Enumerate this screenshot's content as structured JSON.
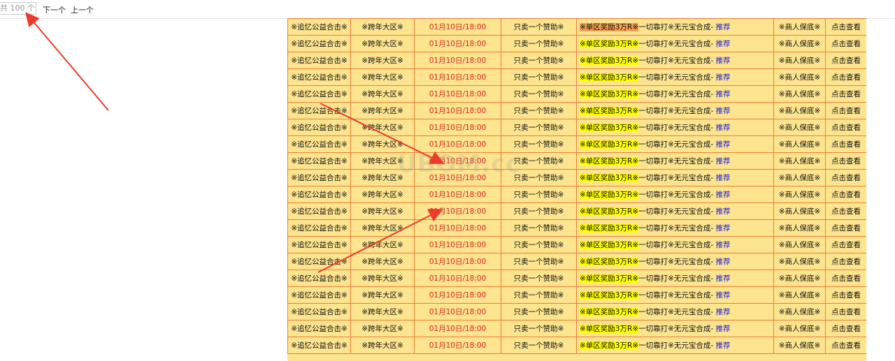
{
  "find_bar": {
    "count_text": "共 100 个",
    "next_label": "下一个",
    "prev_label": "上一个"
  },
  "watermark": "UBOM.cc",
  "colors": {
    "table_bg": "#fde48f",
    "border": "#f07d35",
    "date_text": "#dd2222",
    "highlight": "#ffff00",
    "highlight_current": "#f5a050",
    "link": "#2020d8",
    "arrow": "#ee3a2a"
  },
  "rows": [
    {
      "name": "※追忆公益合击※",
      "zone": "※跨年大区※",
      "date": "01月10日/18:00",
      "slogan": "只卖一个赞助※",
      "desc_hl": "※单区奖励3万R※",
      "desc_rest": "一切靠打※无元宝合成-",
      "rec": "推荐",
      "guarantee": "※商人保底※",
      "view": "点击查看"
    },
    {
      "name": "※追忆公益合击※",
      "zone": "※跨年大区※",
      "date": "01月10日/18:00",
      "slogan": "只卖一个赞助※",
      "desc_hl": "※单区奖励3万R※",
      "desc_rest": "一切靠打※无元宝合成-",
      "rec": "推荐",
      "guarantee": "※商人保底※",
      "view": "点击查看"
    },
    {
      "name": "※追忆公益合击※",
      "zone": "※跨年大区※",
      "date": "01月10日/18:00",
      "slogan": "只卖一个赞助※",
      "desc_hl": "※单区奖励3万R※",
      "desc_rest": "一切靠打※无元宝合成-",
      "rec": "推荐",
      "guarantee": "※商人保底※",
      "view": "点击查看"
    },
    {
      "name": "※追忆公益合击※",
      "zone": "※跨年大区※",
      "date": "01月10日/18:00",
      "slogan": "只卖一个赞助※",
      "desc_hl": "※单区奖励3万R※",
      "desc_rest": "一切靠打※无元宝合成-",
      "rec": "推荐",
      "guarantee": "※商人保底※",
      "view": "点击查看"
    },
    {
      "name": "※追忆公益合击※",
      "zone": "※跨年大区※",
      "date": "01月10日/18:00",
      "slogan": "只卖一个赞助※",
      "desc_hl": "※单区奖励3万R※",
      "desc_rest": "一切靠打※无元宝合成-",
      "rec": "推荐",
      "guarantee": "※商人保底※",
      "view": "点击查看"
    },
    {
      "name": "※追忆公益合击※",
      "zone": "※跨年大区※",
      "date": "01月10日/18:00",
      "slogan": "只卖一个赞助※",
      "desc_hl": "※单区奖励3万R※",
      "desc_rest": "一切靠打※无元宝合成-",
      "rec": "推荐",
      "guarantee": "※商人保底※",
      "view": "点击查看"
    },
    {
      "name": "※追忆公益合击※",
      "zone": "※跨年大区※",
      "date": "01月10日/18:00",
      "slogan": "只卖一个赞助※",
      "desc_hl": "※单区奖励3万R※",
      "desc_rest": "一切靠打※无元宝合成-",
      "rec": "推荐",
      "guarantee": "※商人保底※",
      "view": "点击查看"
    },
    {
      "name": "※追忆公益合击※",
      "zone": "※跨年大区※",
      "date": "01月10日/18:00",
      "slogan": "只卖一个赞助※",
      "desc_hl": "※单区奖励3万R※",
      "desc_rest": "一切靠打※无元宝合成-",
      "rec": "推荐",
      "guarantee": "※商人保底※",
      "view": "点击查看"
    },
    {
      "name": "※追忆公益合击※",
      "zone": "※跨年大区※",
      "date": "01月10日/18:00",
      "slogan": "只卖一个赞助※",
      "desc_hl": "※单区奖励3万R※",
      "desc_rest": "一切靠打※无元宝合成-",
      "rec": "推荐",
      "guarantee": "※商人保底※",
      "view": "点击查看"
    },
    {
      "name": "※追忆公益合击※",
      "zone": "※跨年大区※",
      "date": "01月10日/18:00",
      "slogan": "只卖一个赞助※",
      "desc_hl": "※单区奖励3万R※",
      "desc_rest": "一切靠打※无元宝合成-",
      "rec": "推荐",
      "guarantee": "※商人保底※",
      "view": "点击查看"
    },
    {
      "name": "※追忆公益合击※",
      "zone": "※跨年大区※",
      "date": "01月10日/18:00",
      "slogan": "只卖一个赞助※",
      "desc_hl": "※单区奖励3万R※",
      "desc_rest": "一切靠打※无元宝合成-",
      "rec": "推荐",
      "guarantee": "※商人保底※",
      "view": "点击查看"
    },
    {
      "name": "※追忆公益合击※",
      "zone": "※跨年大区※",
      "date": "01月10日/18:00",
      "slogan": "只卖一个赞助※",
      "desc_hl": "※单区奖励3万R※",
      "desc_rest": "一切靠打※无元宝合成-",
      "rec": "推荐",
      "guarantee": "※商人保底※",
      "view": "点击查看"
    },
    {
      "name": "※追忆公益合击※",
      "zone": "※跨年大区※",
      "date": "01月10日/18:00",
      "slogan": "只卖一个赞助※",
      "desc_hl": "※单区奖励3万R※",
      "desc_rest": "一切靠打※无元宝合成-",
      "rec": "推荐",
      "guarantee": "※商人保底※",
      "view": "点击查看"
    },
    {
      "name": "※追忆公益合击※",
      "zone": "※跨年大区※",
      "date": "01月10日/18:00",
      "slogan": "只卖一个赞助※",
      "desc_hl": "※单区奖励3万R※",
      "desc_rest": "一切靠打※无元宝合成-",
      "rec": "推荐",
      "guarantee": "※商人保底※",
      "view": "点击查看"
    },
    {
      "name": "※追忆公益合击※",
      "zone": "※跨年大区※",
      "date": "01月10日/18:00",
      "slogan": "只卖一个赞助※",
      "desc_hl": "※单区奖励3万R※",
      "desc_rest": "一切靠打※无元宝合成-",
      "rec": "推荐",
      "guarantee": "※商人保底※",
      "view": "点击查看"
    },
    {
      "name": "※追忆公益合击※",
      "zone": "※跨年大区※",
      "date": "01月10日/18:00",
      "slogan": "只卖一个赞助※",
      "desc_hl": "※单区奖励3万R※",
      "desc_rest": "一切靠打※无元宝合成-",
      "rec": "推荐",
      "guarantee": "※商人保底※",
      "view": "点击查看"
    },
    {
      "name": "※追忆公益合击※",
      "zone": "※跨年大区※",
      "date": "01月10日/18:00",
      "slogan": "只卖一个赞助※",
      "desc_hl": "※单区奖励3万R※",
      "desc_rest": "一切靠打※无元宝合成-",
      "rec": "推荐",
      "guarantee": "※商人保底※",
      "view": "点击查看"
    },
    {
      "name": "※追忆公益合击※",
      "zone": "※跨年大区※",
      "date": "01月10日/18:00",
      "slogan": "只卖一个赞助※",
      "desc_hl": "※单区奖励3万R※",
      "desc_rest": "一切靠打※无元宝合成-",
      "rec": "推荐",
      "guarantee": "※商人保底※",
      "view": "点击查看"
    },
    {
      "name": "※追忆公益合击※",
      "zone": "※跨年大区※",
      "date": "01月10日/18:00",
      "slogan": "只卖一个赞助※",
      "desc_hl": "※单区奖励3万R※",
      "desc_rest": "一切靠打※无元宝合成-",
      "rec": "推荐",
      "guarantee": "※商人保底※",
      "view": "点击查看"
    },
    {
      "name": "※追忆公益合击※",
      "zone": "※跨年大区※",
      "date": "01月10日/18:00",
      "slogan": "只卖一个赞助※",
      "desc_hl": "※单区奖励3万R※",
      "desc_rest": "一切靠打※无元宝合成-",
      "rec": "推荐",
      "guarantee": "※商人保底※",
      "view": "点击查看"
    }
  ]
}
